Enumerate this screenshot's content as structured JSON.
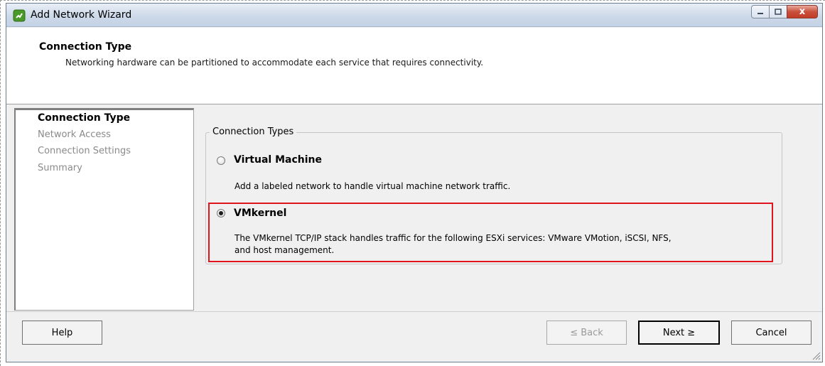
{
  "window": {
    "title": "Add Network Wizard",
    "close_glyph": "x"
  },
  "header": {
    "title": "Connection Type",
    "description": "Networking hardware can be partitioned to accommodate each service that requires connectivity."
  },
  "sidebar": {
    "steps": [
      {
        "label": "Connection Type",
        "current": true
      },
      {
        "label": "Network Access",
        "current": false
      },
      {
        "label": "Connection Settings",
        "current": false
      },
      {
        "label": "Summary",
        "current": false
      }
    ]
  },
  "connection_types": {
    "legend": "Connection Types",
    "options": [
      {
        "label": "Virtual Machine",
        "description": "Add a labeled network to handle virtual machine network traffic.",
        "selected": false
      },
      {
        "label": "VMkernel",
        "description_line1": "The VMkernel TCP/IP stack handles traffic for the following ESXi services: VMware VMotion, iSCSI, NFS,",
        "description_line2": "and host management.",
        "selected": true
      }
    ]
  },
  "buttons": {
    "help": "Help",
    "back": "≤ Back",
    "next": "Next ≥",
    "cancel": "Cancel"
  },
  "colors": {
    "highlight": "#e0141e",
    "titlebar": "#cbd8e8"
  }
}
